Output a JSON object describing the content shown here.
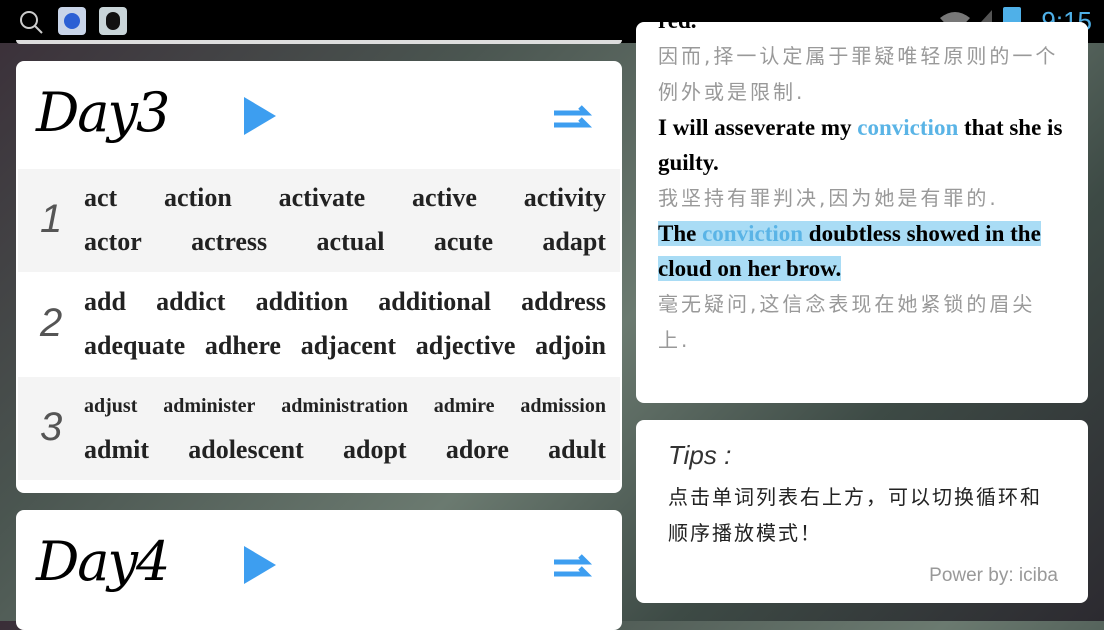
{
  "status_bar": {
    "time": "9:15",
    "icons": [
      "search-icon",
      "baidu-icon",
      "qq-reader-icon",
      "wifi-icon",
      "signal-icon",
      "battery-icon"
    ]
  },
  "day3": {
    "title": "Day3",
    "groups": [
      {
        "num": "1",
        "rows": [
          [
            "act",
            "action",
            "activate",
            "active",
            "activity"
          ],
          [
            "actor",
            "actress",
            "actual",
            "acute",
            "adapt"
          ]
        ]
      },
      {
        "num": "2",
        "rows": [
          [
            "add",
            "addict",
            "addition",
            "additional",
            "address"
          ],
          [
            "adequate",
            "adhere",
            "adjacent",
            "adjective",
            "adjoin"
          ]
        ]
      },
      {
        "num": "3",
        "rows": [
          [
            "adjust",
            "administer",
            "administration",
            "admire",
            "admission"
          ],
          [
            "admit",
            "adolescent",
            "adopt",
            "adore",
            "adult"
          ]
        ]
      }
    ]
  },
  "day4": {
    "title": "Day4"
  },
  "examples": {
    "cut_text": "red.",
    "zh1": "因而,择一认定属于罪疑唯轻原则的一个例外或是限制.",
    "ex2_pre": "I will asseverate my ",
    "ex2_word": "conviction",
    "ex2_post": " that she is guilty.",
    "zh2": "我坚持有罪判决,因为她是有罪的.",
    "ex3_pre": "The ",
    "ex3_word": "conviction",
    "ex3_post": " doubtless showed in the cloud on her brow.",
    "zh3": "毫无疑问,这信念表现在她紧锁的眉尖上."
  },
  "tips": {
    "title": "Tips :",
    "body": "点击单词列表右上方，可以切换循环和顺序播放模式！",
    "credit": "Power by: iciba"
  },
  "colors": {
    "accent": "#3d9ef0",
    "highlight_word": "#5ab4e6",
    "selection": "#a9dcf5"
  }
}
